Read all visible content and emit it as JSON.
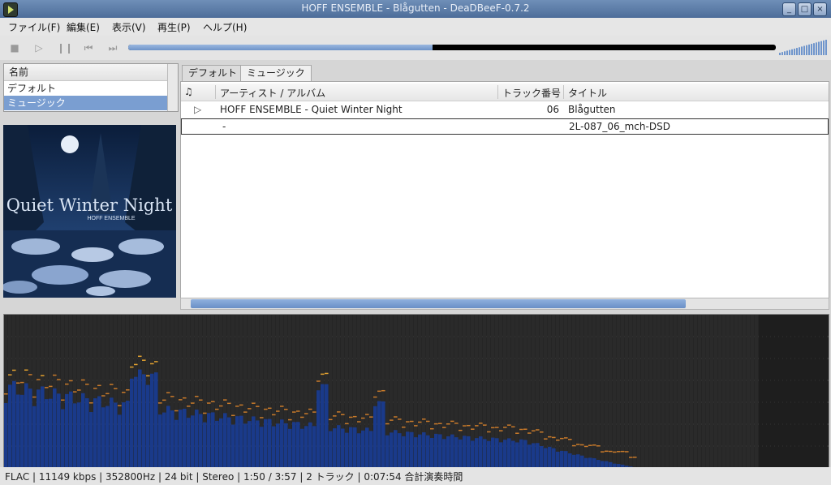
{
  "window": {
    "title": "HOFF ENSEMBLE - Blågutten - DeaDBeeF-0.7.2"
  },
  "menu": [
    "ファイル(F)",
    "編集(E)",
    "表示(V)",
    "再生(P)",
    "ヘルプ(H)"
  ],
  "playback": {
    "progress": 0.47,
    "volume": 1.0
  },
  "playlists": {
    "header": "名前",
    "items": [
      "デフォルト",
      "ミュージック"
    ],
    "selected_index": 1
  },
  "album_art": {
    "title": "Quiet Winter Night",
    "artist": "HOFF ENSEMBLE"
  },
  "tabs": [
    "デフォルト",
    "ミュージック"
  ],
  "active_tab": 1,
  "columns": {
    "playing": "♫",
    "artist_album": "アーティスト / アルバム",
    "track_no": "トラック番号",
    "title": "タイトル"
  },
  "rows": [
    {
      "artist_album": "HOFF ENSEMBLE - Quiet Winter Night",
      "track_no": "06",
      "title": "Blågutten",
      "playing": true
    },
    {
      "artist_album": "-",
      "track_no": "",
      "title": "2L-087_06_mch-DSD",
      "playing": false
    }
  ],
  "status": "FLAC | 11149 kbps | 352800Hz | 24 bit | Stereo | 1:50 / 3:57 | 2 トラック | 0:07:54 合計演奏時間",
  "colors": {
    "accent": "#7a9ed1",
    "titlebar": "#5b7aa8"
  }
}
